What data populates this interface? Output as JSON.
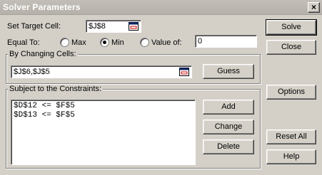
{
  "window": {
    "title": "Solver Parameters",
    "close_glyph": "×"
  },
  "target": {
    "label_pre": "Set Target Cell:",
    "value": "$J$8"
  },
  "equal_to": {
    "label": "Equal To:",
    "options": [
      "Max",
      "Min",
      "Value of:"
    ],
    "selected": "Min",
    "value_of": "0"
  },
  "changing": {
    "group_label": "By Changing Cells:",
    "value": "$J$6,$J$5",
    "guess_label": "Guess"
  },
  "constraints": {
    "group_label": "Subject to the Constraints:",
    "items": [
      "$D$12 <= $F$5",
      "$D$13 <= $F$5"
    ],
    "add_label": "Add",
    "change_label": "Change",
    "delete_label": "Delete"
  },
  "right_buttons": {
    "solve": "Solve",
    "close": "Close",
    "options": "Options",
    "reset": "Reset All",
    "help": "Help"
  },
  "icons": {
    "refedit": "collapse-dialog-icon",
    "radio": "radio-button-icon"
  }
}
